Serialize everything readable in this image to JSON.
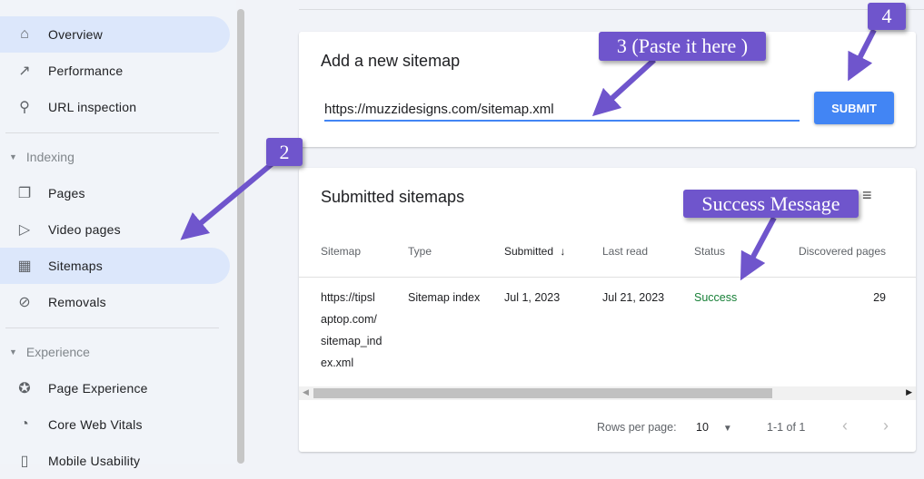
{
  "sidebar": {
    "items": [
      {
        "label": "Overview",
        "icon": "home-icon",
        "active": true
      },
      {
        "label": "Performance",
        "icon": "trending-up-icon"
      },
      {
        "label": "URL inspection",
        "icon": "search-icon"
      },
      {
        "label": "Pages",
        "icon": "pages-icon"
      },
      {
        "label": "Video pages",
        "icon": "video-pages-icon"
      },
      {
        "label": "Sitemaps",
        "icon": "sitemap-icon",
        "active": true
      },
      {
        "label": "Removals",
        "icon": "eye-off-icon"
      },
      {
        "label": "Page Experience",
        "icon": "page-experience-icon"
      },
      {
        "label": "Core Web Vitals",
        "icon": "gauge-icon"
      },
      {
        "label": "Mobile Usability",
        "icon": "phone-icon"
      }
    ],
    "sections": [
      "Indexing",
      "Experience"
    ]
  },
  "add": {
    "title": "Add a new sitemap",
    "value": "https://muzzidesigns.com/sitemap.xml",
    "submit": "SUBMIT"
  },
  "submitted": {
    "title": "Submitted sitemaps",
    "columns": [
      "Sitemap",
      "Type",
      "Submitted",
      "Last read",
      "Status",
      "Discovered pages"
    ],
    "rows": [
      {
        "sitemap_lines": [
          "https://tipsl",
          "aptop.com/",
          "sitemap_ind",
          "ex.xml"
        ],
        "type": "Sitemap index",
        "submitted": "Jul 1, 2023",
        "last_read": "Jul 21, 2023",
        "status": "Success",
        "discovered": "29"
      }
    ],
    "footer": {
      "rows_label": "Rows per page:",
      "rows_value": "10",
      "range": "1-1 of 1"
    }
  },
  "annotations": {
    "step2": "2",
    "step3": "3 (Paste it here )",
    "step4": "4",
    "success": "Success Message"
  },
  "colors": {
    "accent": "#4285f4",
    "success": "#188038",
    "callout": "#6f55cc",
    "active_nav": "#dce7fb"
  }
}
